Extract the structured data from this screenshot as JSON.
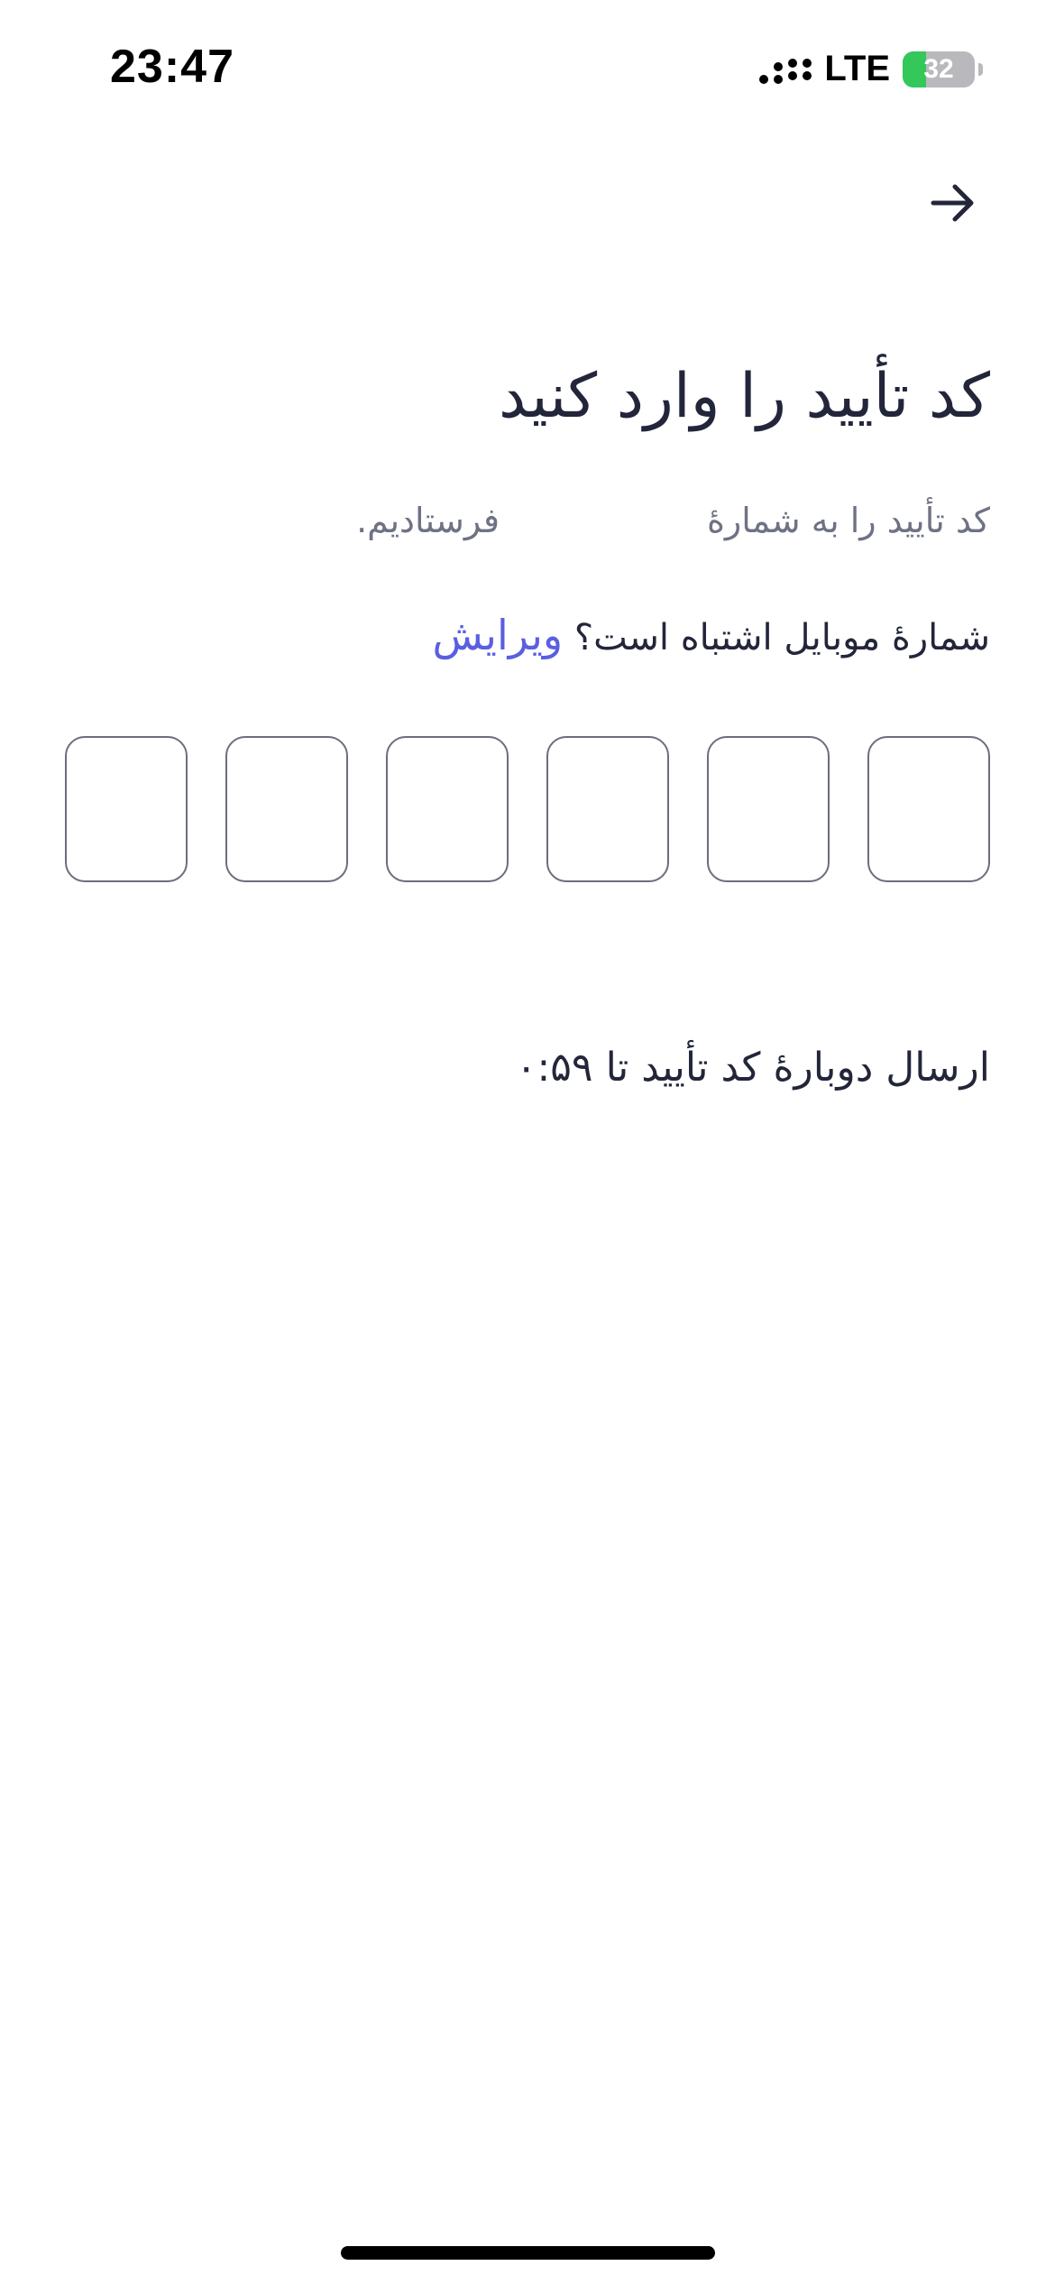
{
  "status_bar": {
    "time": "23:47",
    "network": "LTE",
    "battery_level": "32",
    "battery_fraction": 0.32,
    "battery_color": "#34c759"
  },
  "header": {
    "back_icon": "arrow-right-icon"
  },
  "main": {
    "title": "کد تأیید را وارد کنید",
    "subtitle_start": "کد تأیید را به شمارهٔ",
    "subtitle_end": "فرستادیم.",
    "wrong_number_text": "شمارهٔ موبایل اشتباه است؟",
    "edit_label": "ویرایش",
    "edit_color": "#5a5fe0",
    "otp_length": 6,
    "resend_text": "ارسال دوبارهٔ کد تأیید تا ۰:۵۹"
  }
}
